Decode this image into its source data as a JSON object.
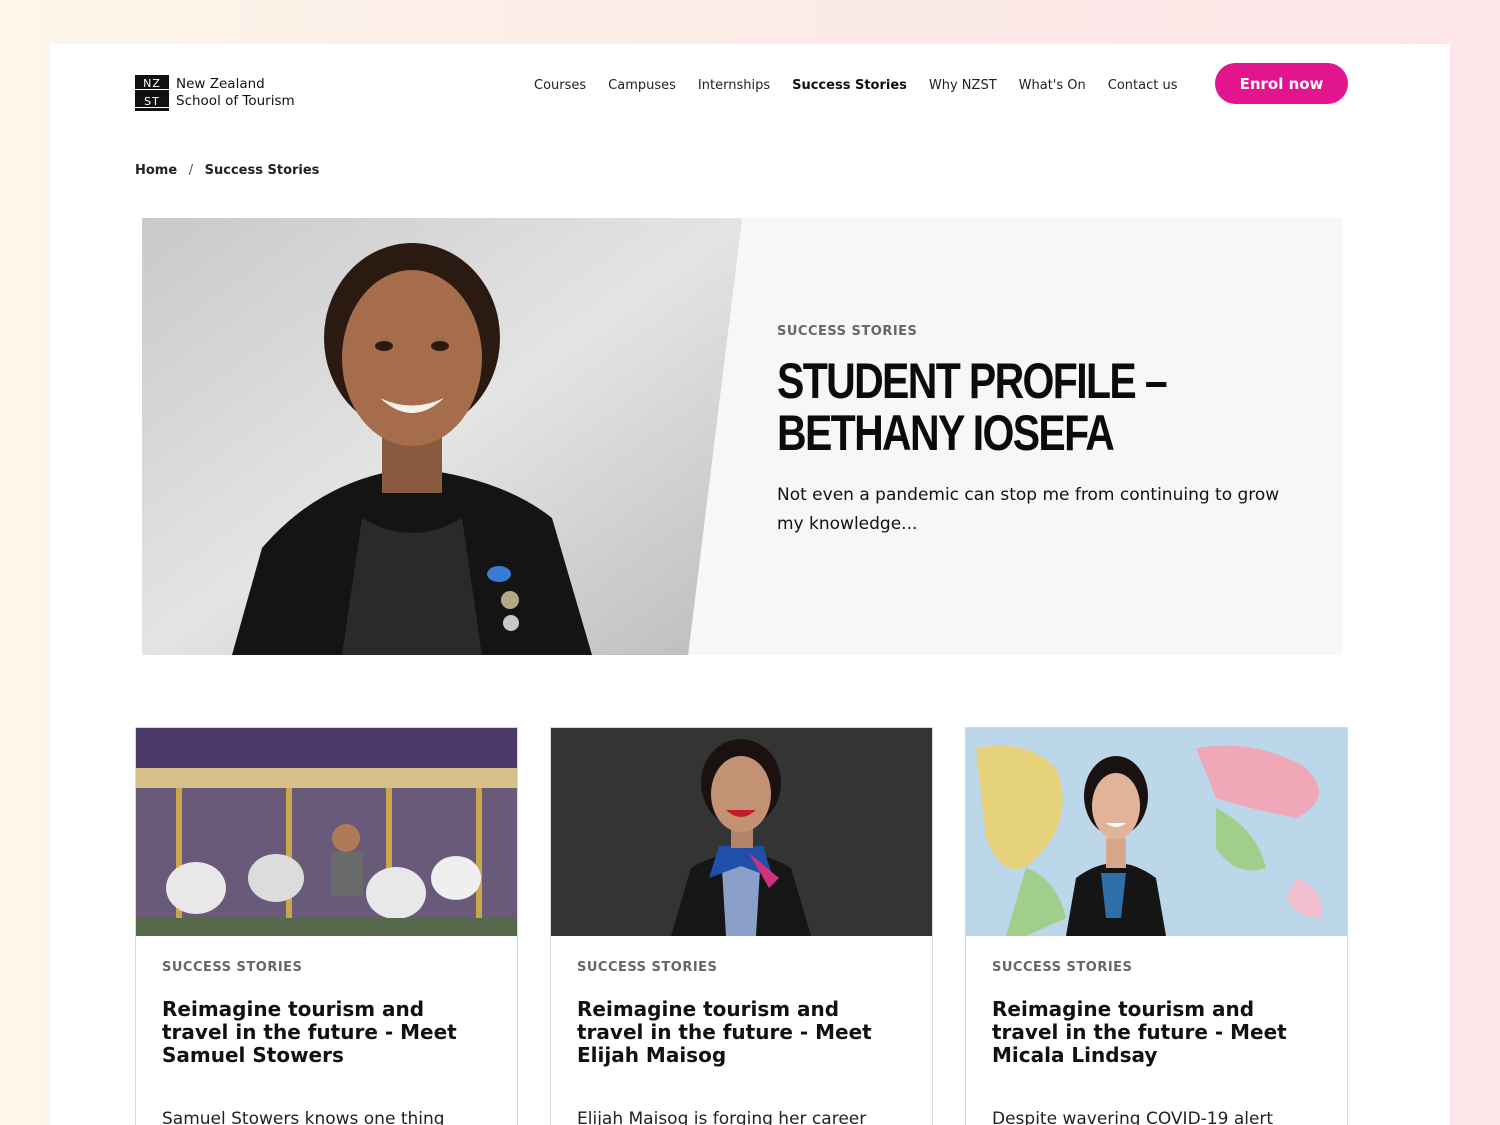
{
  "header": {
    "logo_mark": [
      "NZ",
      "ST"
    ],
    "logo_line1": "New Zealand",
    "logo_line2": "School of Tourism",
    "nav": [
      "Courses",
      "Campuses",
      "Internships",
      "Success Stories",
      "Why NZST",
      "What's On",
      "Contact us"
    ],
    "active_nav": "Success Stories",
    "enrol_label": "Enrol now"
  },
  "colors": {
    "accent": "#e2158f",
    "hero_bg": "#f7f7f7",
    "text": "#111111"
  },
  "breadcrumb": {
    "home": "Home",
    "sep": "/",
    "current": "Success Stories"
  },
  "hero": {
    "eyebrow": "SUCCESS STORIES",
    "title": "STUDENT PROFILE – BETHANY IOSEFA",
    "subtitle": "Not even a pandemic can stop me from continuing to grow my knowledge..."
  },
  "cards": [
    {
      "eyebrow": "SUCCESS STORIES",
      "title": "Reimagine tourism and travel in the future - Meet Samuel Stowers",
      "excerpt": "Samuel Stowers knows one thing"
    },
    {
      "eyebrow": "SUCCESS STORIES",
      "title": "Reimagine tourism and travel in the future - Meet Elijah Maisog",
      "excerpt": "Elijah Maisog is forging her career"
    },
    {
      "eyebrow": "SUCCESS STORIES",
      "title": "Reimagine tourism and travel in the future - Meet Micala Lindsay",
      "excerpt": "Despite wavering COVID-19 alert"
    }
  ]
}
